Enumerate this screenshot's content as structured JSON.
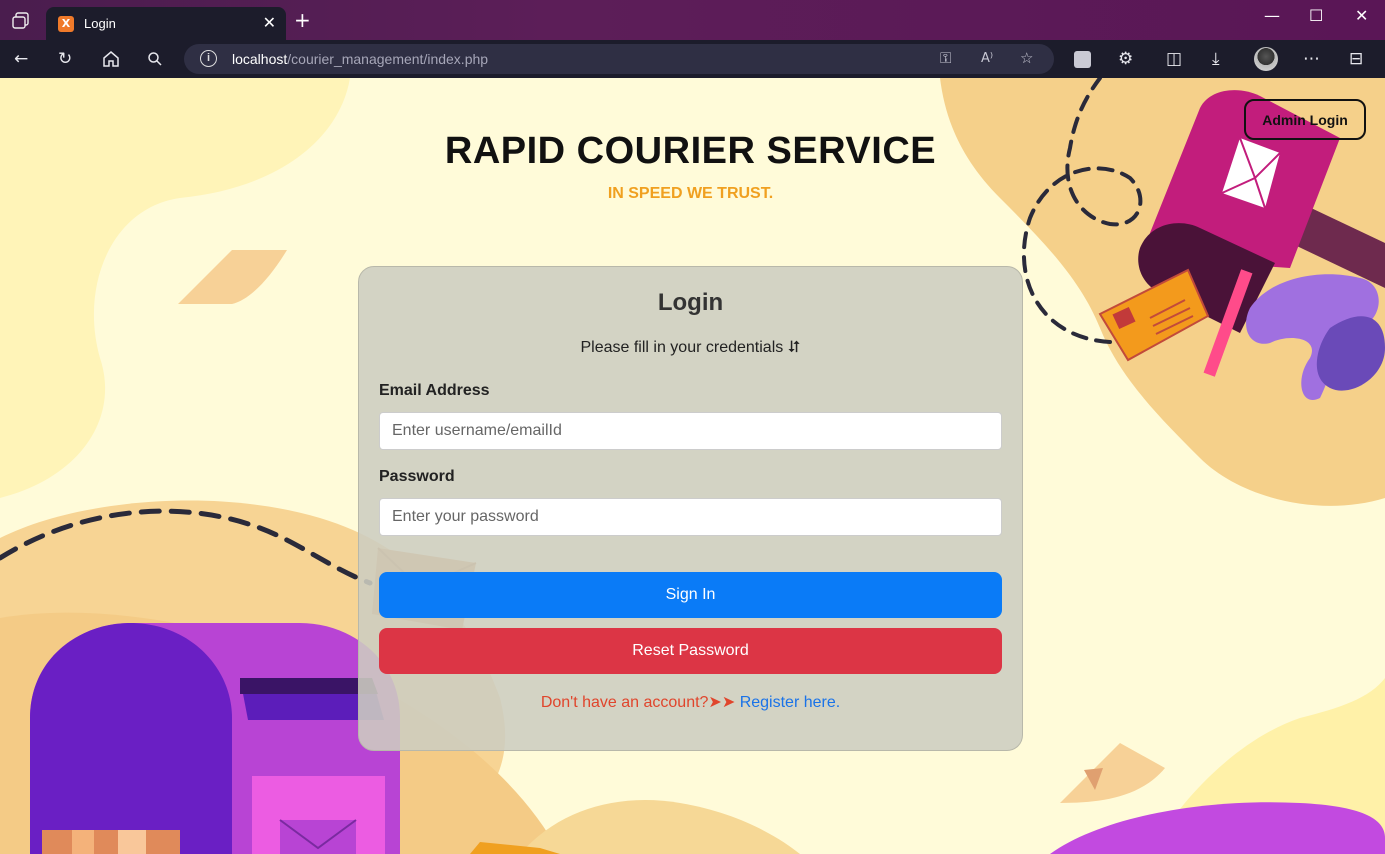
{
  "browser": {
    "tab_title": "Login",
    "tab_favicon": "xampp-icon",
    "url_host": "localhost",
    "url_path": "/courier_management/index.php"
  },
  "header": {
    "admin_login_label": "Admin Login",
    "title": "RAPID COURIER SERVICE",
    "tagline": "IN SPEED WE TRUST."
  },
  "login": {
    "title": "Login",
    "subtitle": "Please fill in your credentials ⮃",
    "email_label": "Email Address",
    "email_placeholder": "Enter username/emailId",
    "password_label": "Password",
    "password_placeholder": "Enter your password",
    "signin_label": "Sign In",
    "reset_label": "Reset Password",
    "register_prompt": "Don't have an account?➤➤ ",
    "register_link": "Register here."
  },
  "colors": {
    "accent_orange": "#f0a020",
    "primary_blue": "#0a7bf7",
    "danger_red": "#dc3545",
    "link_blue": "#1a73e8",
    "background": "#fffbd9"
  }
}
